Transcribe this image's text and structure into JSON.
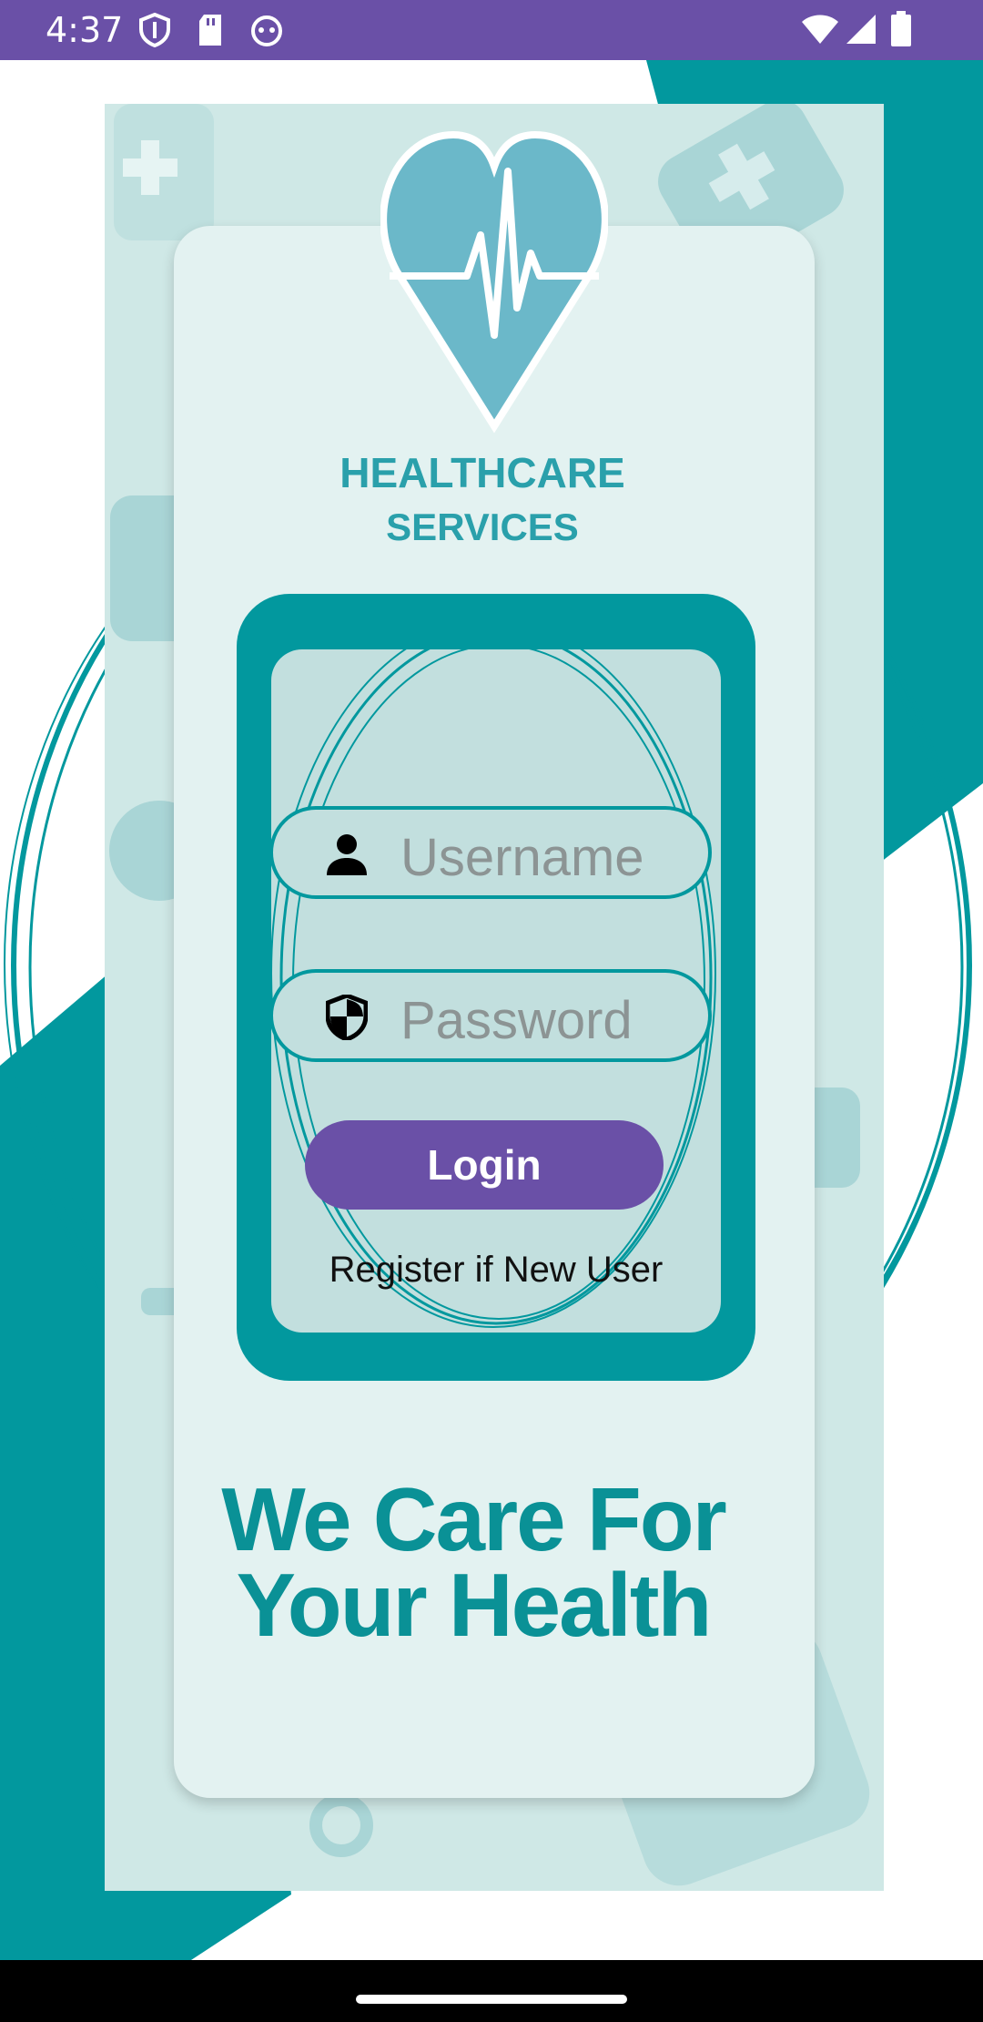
{
  "status_bar": {
    "time": "4:37",
    "left_icons": [
      "shield-icon",
      "sd-card-icon",
      "android-debug-icon"
    ],
    "right_icons": [
      "wifi-icon",
      "signal-icon",
      "battery-icon"
    ]
  },
  "brand": {
    "line1": "HEALTHCARE",
    "line2": "SERVICES"
  },
  "login": {
    "username_placeholder": "Username",
    "password_placeholder": "Password",
    "login_label": "Login",
    "register_label": "Register if New User"
  },
  "tagline": {
    "line1": "We Care For",
    "line2": "Your Health"
  },
  "colors": {
    "status_bar": "#6a50a7",
    "accent_teal": "#02989e",
    "login_button": "#6a50a7",
    "panel": "#cfe8e6"
  }
}
